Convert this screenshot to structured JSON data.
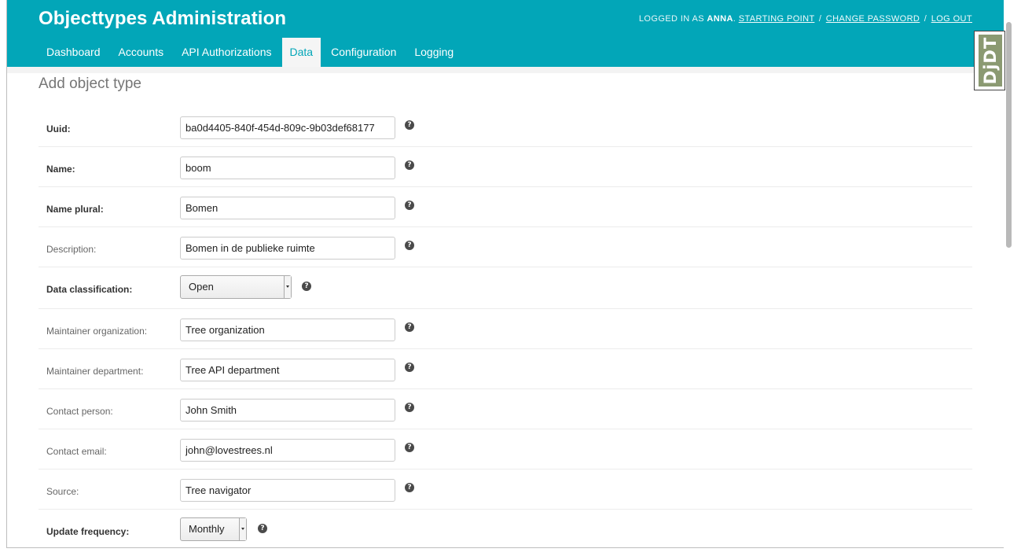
{
  "header": {
    "title": "Objecttypes Administration",
    "logged_in_prefix": "Logged in as",
    "username": "anna",
    "links": {
      "starting_point": "Starting point",
      "change_password": "Change password",
      "log_out": "Log out"
    },
    "separator": "/"
  },
  "nav": {
    "tabs": [
      {
        "label": "Dashboard"
      },
      {
        "label": "Accounts"
      },
      {
        "label": "API Authorizations"
      },
      {
        "label": "Data",
        "active": true
      },
      {
        "label": "Configuration"
      },
      {
        "label": "Logging"
      }
    ]
  },
  "page": {
    "title": "Add object type"
  },
  "form": {
    "uuid": {
      "label": "Uuid:",
      "value": "ba0d4405-840f-454d-809c-9b03def68177",
      "required": true
    },
    "name": {
      "label": "Name:",
      "value": "boom",
      "required": true
    },
    "name_plural": {
      "label": "Name plural:",
      "value": "Bomen",
      "required": true
    },
    "description": {
      "label": "Description:",
      "value": "Bomen in de publieke ruimte",
      "required": false
    },
    "data_classification": {
      "label": "Data classification:",
      "value": "Open",
      "required": true
    },
    "maintainer_organization": {
      "label": "Maintainer organization:",
      "value": "Tree organization",
      "required": false
    },
    "maintainer_department": {
      "label": "Maintainer department:",
      "value": "Tree API department",
      "required": false
    },
    "contact_person": {
      "label": "Contact person:",
      "value": "John Smith",
      "required": false
    },
    "contact_email": {
      "label": "Contact email:",
      "value": "john@lovestrees.nl",
      "required": false
    },
    "source": {
      "label": "Source:",
      "value": "Tree navigator",
      "required": false
    },
    "update_frequency": {
      "label": "Update frequency:",
      "value": "Monthly",
      "required": true
    }
  },
  "help_icon": "?",
  "debug_toolbar": {
    "label": "DjDT"
  },
  "colors": {
    "header": "#02a6b8",
    "active_tab_bg": "#f5f5f5",
    "active_tab_text": "#02a6b8"
  }
}
